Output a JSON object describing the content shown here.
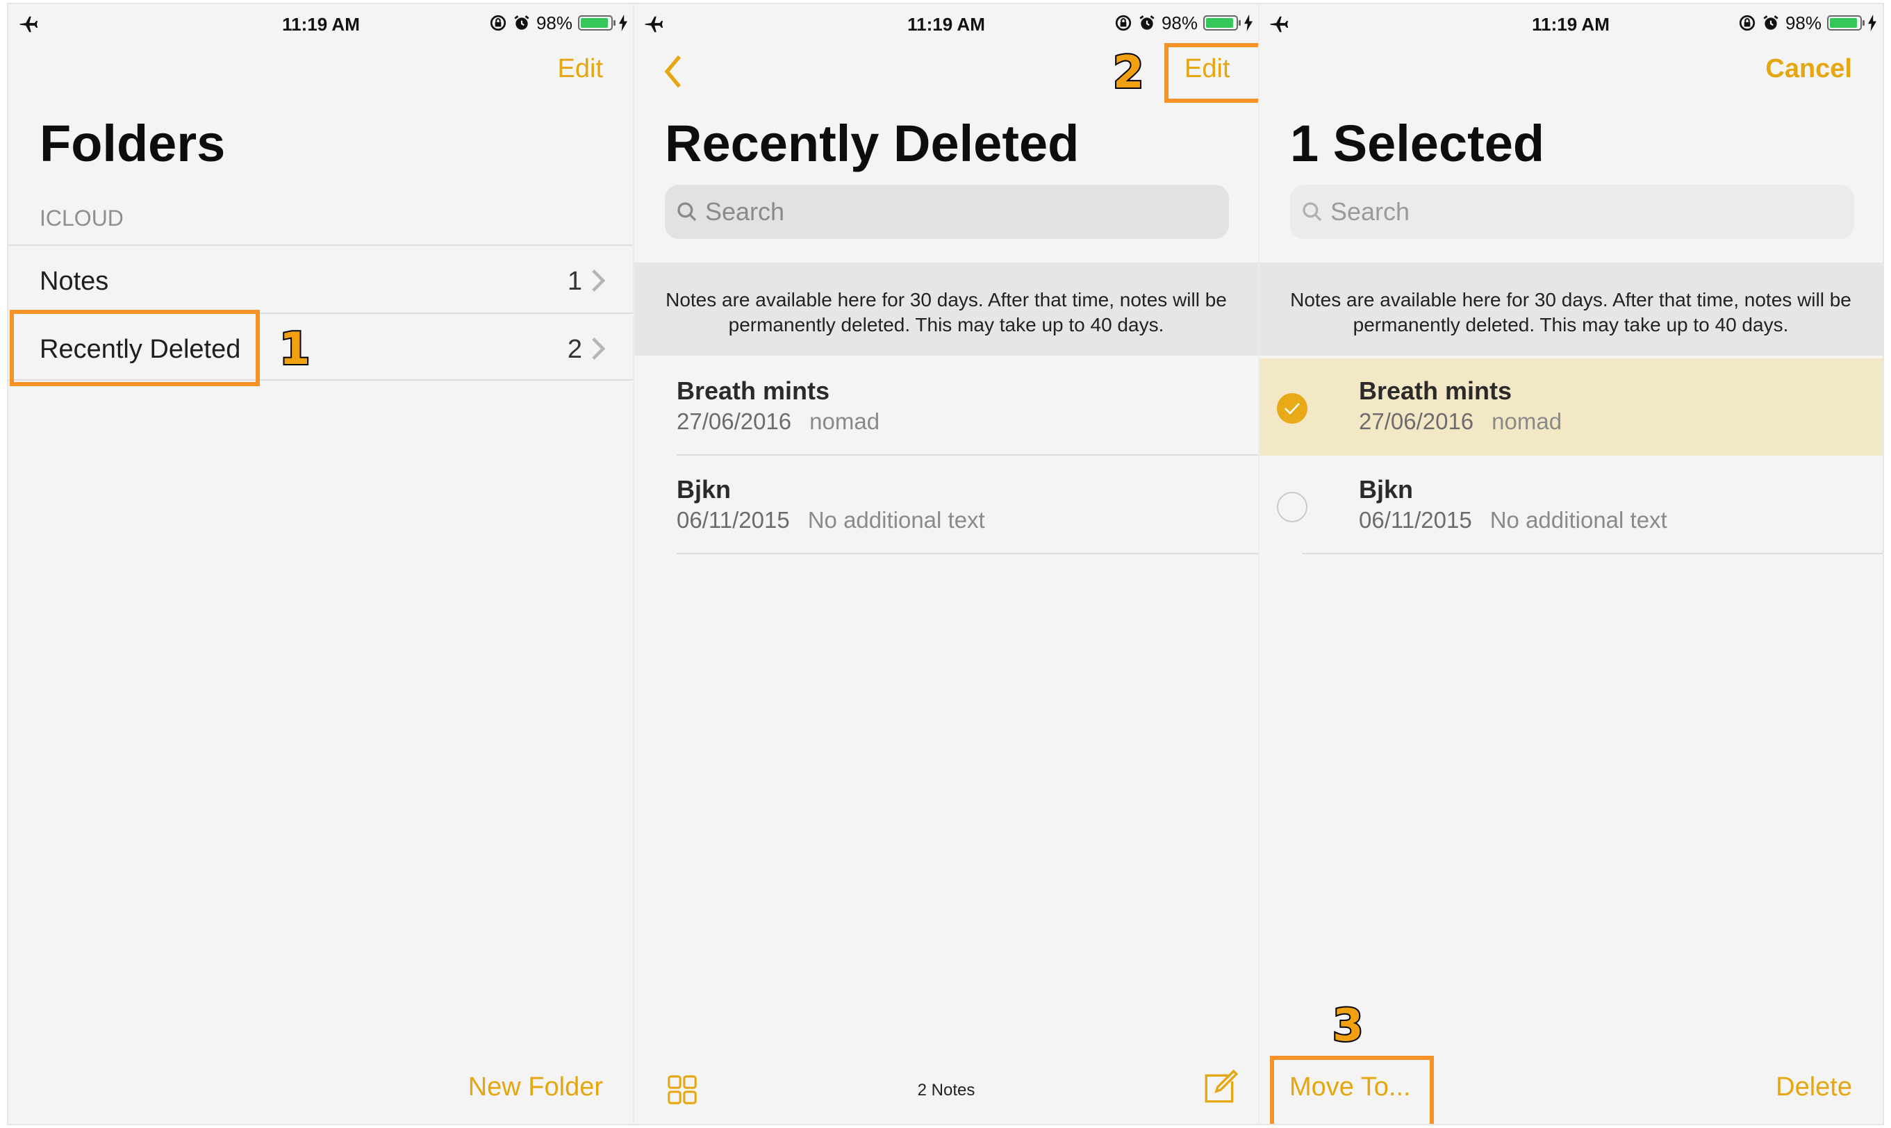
{
  "status_bar": {
    "time": "11:19 AM",
    "battery": "98%"
  },
  "panel1": {
    "nav_right": "Edit",
    "title": "Folders",
    "section": "ICLOUD",
    "rows": [
      {
        "label": "Notes",
        "count": "1"
      },
      {
        "label": "Recently Deleted",
        "count": "2"
      }
    ],
    "toolbar": {
      "new_folder": "New Folder"
    }
  },
  "panel2": {
    "nav_right": "Edit",
    "title": "Recently Deleted",
    "search_placeholder": "Search",
    "banner": [
      "Notes are available here for 30 days. After that time, notes will be",
      "permanently deleted. This may take up to 40 days."
    ],
    "notes": [
      {
        "title": "Breath mints",
        "date": "27/06/2016",
        "preview": "nomad"
      },
      {
        "title": "Bjkn",
        "date": "06/11/2015",
        "preview": "No additional text"
      }
    ],
    "toolbar": {
      "count": "2 Notes"
    }
  },
  "panel3": {
    "nav_right": "Cancel",
    "title": "1 Selected",
    "search_placeholder": "Search",
    "banner": [
      "Notes are available here for 30 days. After that time, notes will be",
      "permanently deleted. This may take up to 40 days."
    ],
    "notes": [
      {
        "title": "Breath mints",
        "date": "27/06/2016",
        "preview": "nomad",
        "selected": true
      },
      {
        "title": "Bjkn",
        "date": "06/11/2015",
        "preview": "No additional text",
        "selected": false
      }
    ],
    "toolbar": {
      "move_to": "Move To...",
      "delete": "Delete"
    }
  },
  "annotations": {
    "step1": "1",
    "step2": "2",
    "step3": "3"
  },
  "colors": {
    "accent": "#e5a60f",
    "highlight_box": "#f59227",
    "selected_row": "#f3e8c6",
    "battery": "#34c759"
  },
  "icons": [
    "airplane-icon",
    "rotation-lock-icon",
    "alarm-icon",
    "battery-icon",
    "charging-icon",
    "chevron-right-icon",
    "back-chevron-icon",
    "search-icon",
    "gallery-grid-icon",
    "compose-icon",
    "checkmark-icon"
  ]
}
